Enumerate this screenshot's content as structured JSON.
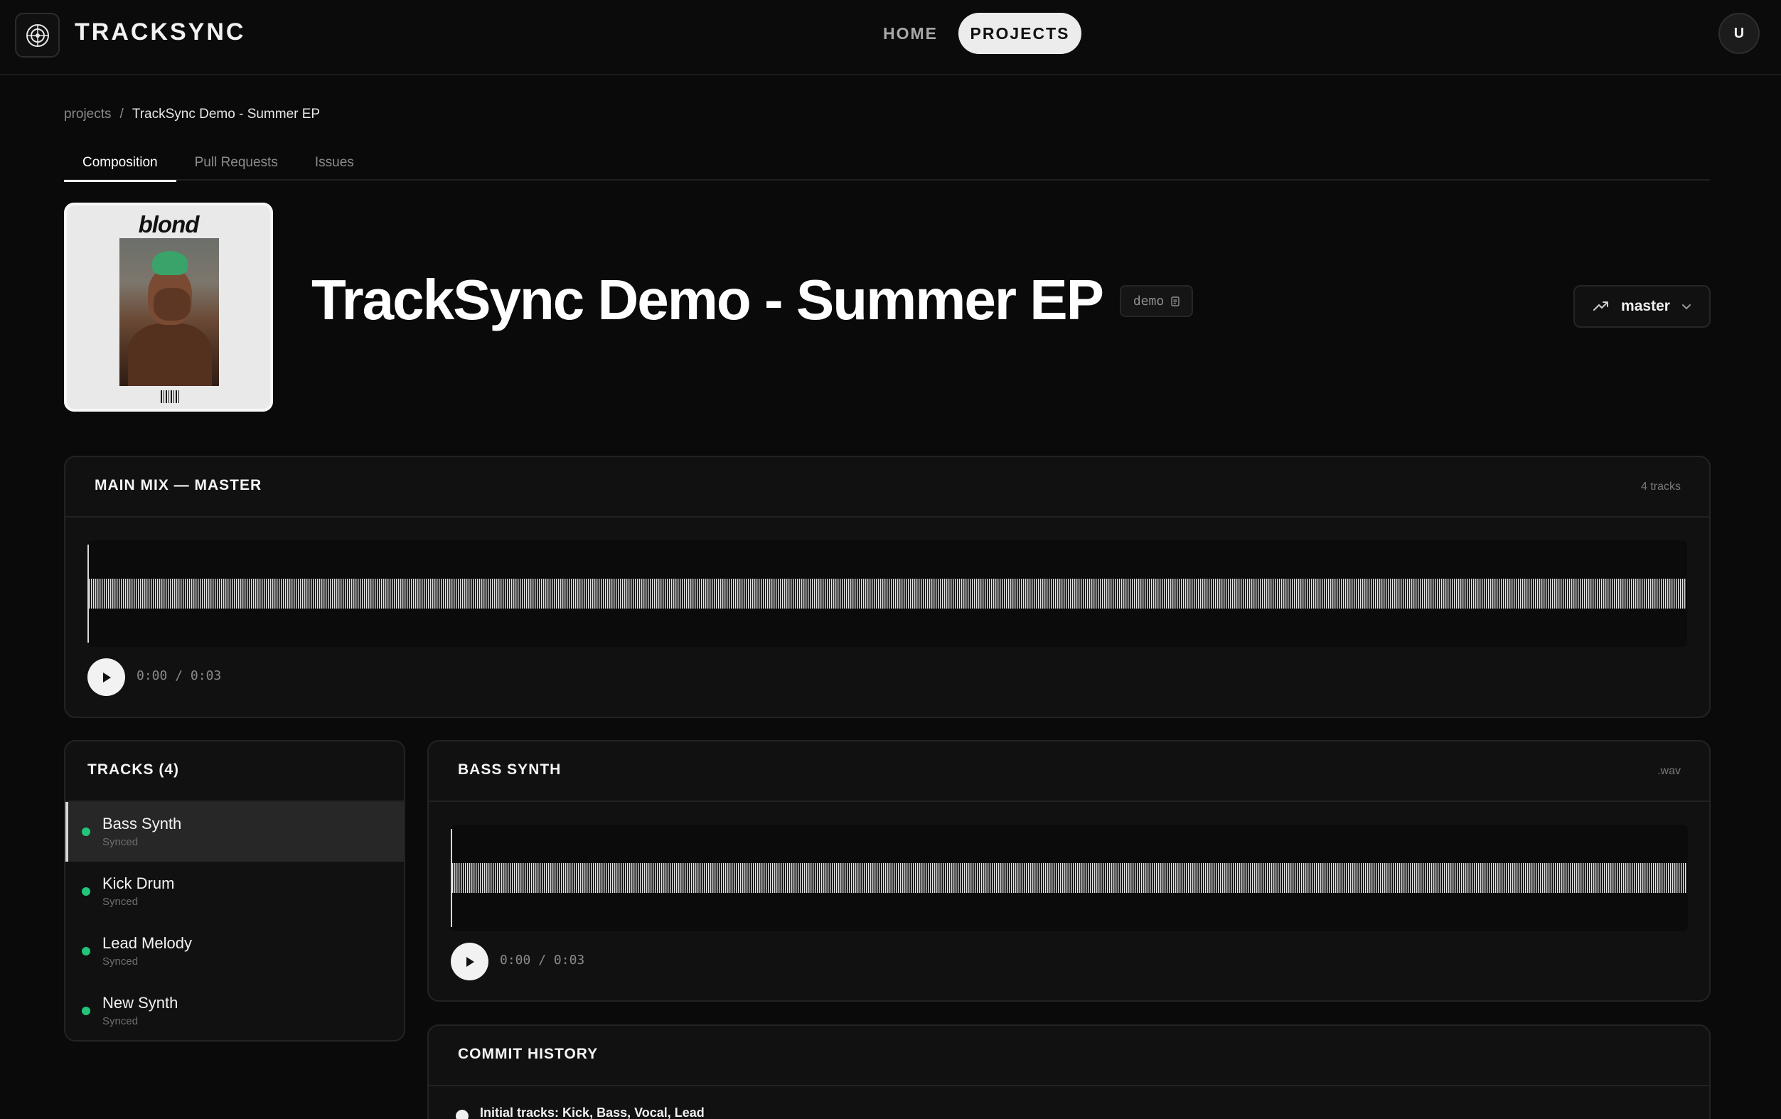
{
  "app": {
    "brand": "TRACKSYNC",
    "nav": {
      "home": "HOME",
      "projects": "PROJECTS"
    },
    "avatar_initial": "U"
  },
  "breadcrumb": {
    "root": "projects",
    "separator": "/",
    "current": "TrackSync Demo - Summer EP"
  },
  "tabs": [
    {
      "label": "Composition",
      "active": true
    },
    {
      "label": "Pull Requests",
      "active": false
    },
    {
      "label": "Issues",
      "active": false
    }
  ],
  "project": {
    "title": "TrackSync Demo - Summer EP",
    "badge": "demo",
    "badge_icon": "file-icon",
    "branch": "master",
    "branch_icon": "trending-icon",
    "cover_title": "blond"
  },
  "main_mix": {
    "title": "MAIN MIX — MASTER",
    "meta": "4 tracks",
    "time_current": "0:00",
    "time_total": "0:03",
    "time_separator": "/"
  },
  "tracks_panel": {
    "title": "TRACKS (4)",
    "items": [
      {
        "name": "Bass Synth",
        "status": "Synced",
        "selected": true
      },
      {
        "name": "Kick Drum",
        "status": "Synced",
        "selected": false
      },
      {
        "name": "Lead Melody",
        "status": "Synced",
        "selected": false
      },
      {
        "name": "New Synth",
        "status": "Synced",
        "selected": false
      }
    ]
  },
  "track_detail": {
    "title": "BASS SYNTH",
    "meta": ".wav",
    "time_current": "0:00",
    "time_total": "0:03",
    "time_separator": "/"
  },
  "commit_history": {
    "title": "COMMIT HISTORY",
    "commits": [
      {
        "message": "Initial tracks: Kick, Bass, Vocal, Lead"
      }
    ]
  },
  "colors": {
    "background": "#0a0a0a",
    "panel": "#111111",
    "accent": "#f2f2f2",
    "synced": "#22c57a"
  }
}
